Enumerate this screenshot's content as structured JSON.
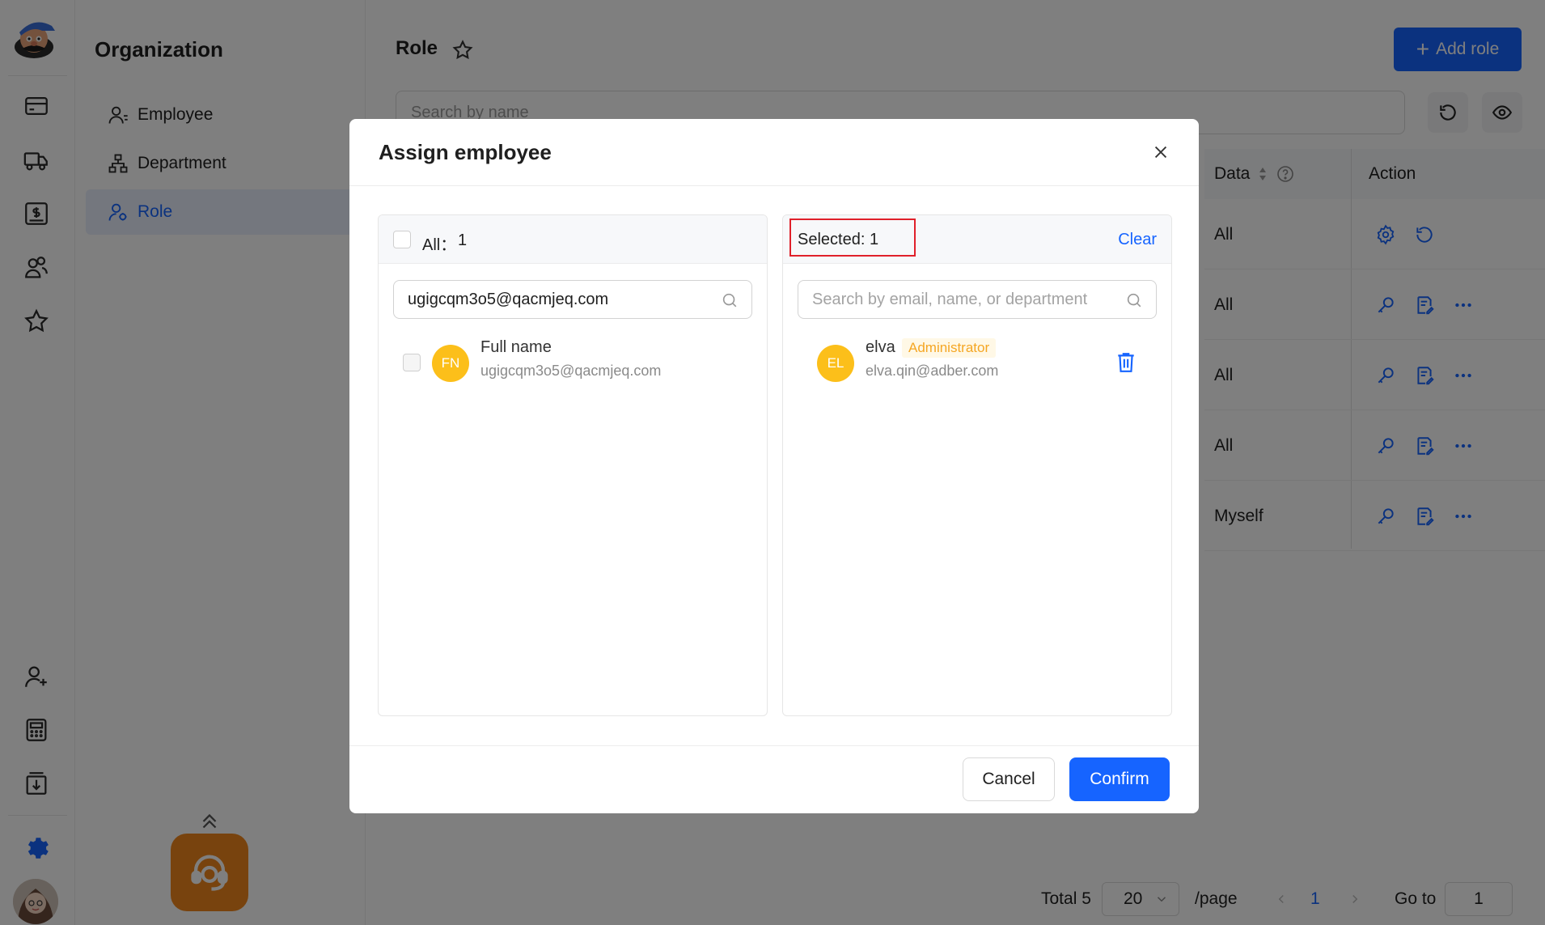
{
  "sidebar": {
    "icons": [
      "wallet-icon",
      "truck-icon",
      "invoice-icon",
      "team-icon",
      "star-icon",
      "add-user-icon",
      "calculator-icon",
      "download-icon",
      "gear-icon"
    ]
  },
  "subnav": {
    "title": "Organization",
    "items": [
      {
        "label": "Employee",
        "icon": "person-icon"
      },
      {
        "label": "Department",
        "icon": "org-chart-icon"
      },
      {
        "label": "Role",
        "icon": "role-icon",
        "active": true
      }
    ]
  },
  "main": {
    "title": "Role",
    "add_button": "Add role",
    "search_placeholder": "Search by name",
    "table": {
      "headers": {
        "data": "Data",
        "action": "Action"
      },
      "rows": [
        {
          "data": "All"
        },
        {
          "data": "All"
        },
        {
          "data": "All"
        },
        {
          "data": "All"
        },
        {
          "data": "Myself"
        }
      ]
    },
    "pagination": {
      "total": "Total 5",
      "page_size": "20",
      "per_page": "/page",
      "current_page": "1",
      "goto_label": "Go to",
      "goto_value": "1"
    }
  },
  "modal": {
    "title": "Assign employee",
    "left_panel": {
      "all_label": "All：",
      "all_count": "1",
      "search_value": "ugigcqm3o5@qacmjeq.com",
      "employees": [
        {
          "initials": "FN",
          "name": "Full name",
          "email": "ugigcqm3o5@qacmjeq.com"
        }
      ]
    },
    "right_panel": {
      "selected_label": "Selected: 1",
      "clear_label": "Clear",
      "search_placeholder": "Search by email, name, or department",
      "employees": [
        {
          "initials": "EL",
          "name": "elva",
          "tag": "Administrator",
          "email": "elva.qin@adber.com"
        }
      ]
    },
    "cancel_label": "Cancel",
    "confirm_label": "Confirm"
  },
  "colors": {
    "primary": "#1664ff",
    "avatar": "#fcbf1a",
    "tag": "#f5a623",
    "highlight_box": "#e0202a",
    "support": "#f0871c"
  }
}
